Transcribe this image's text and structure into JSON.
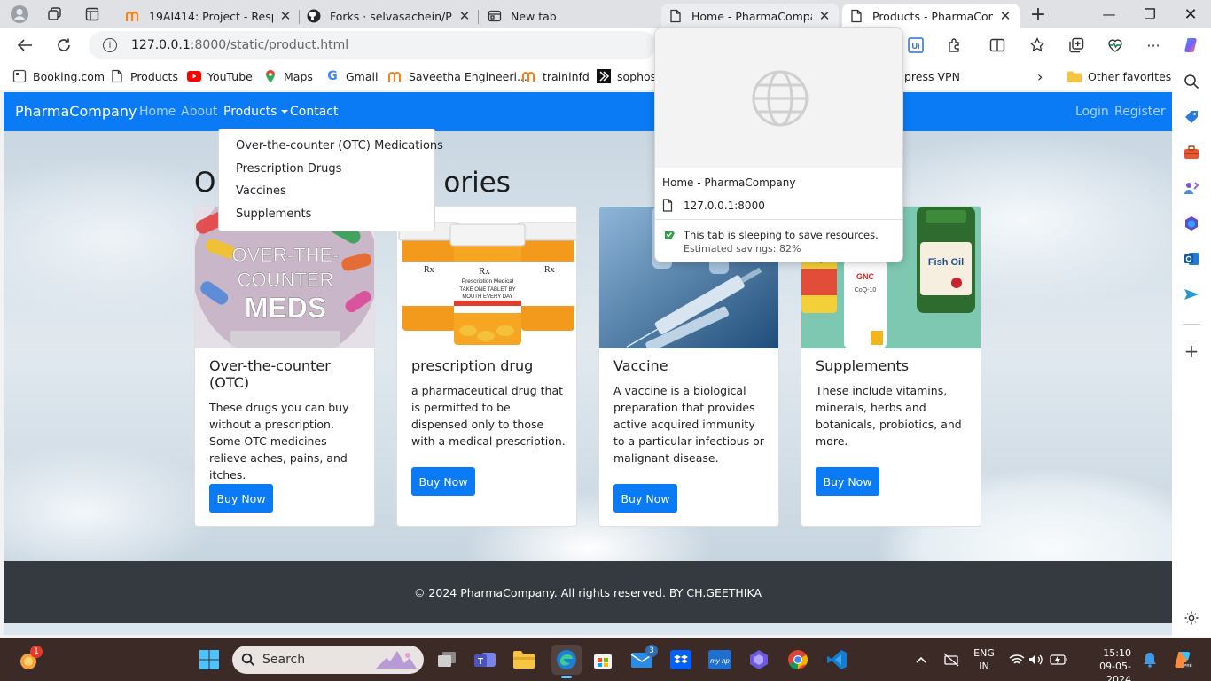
{
  "browser": {
    "tabs": [
      {
        "title": "19AI414: Project - Respon",
        "icon": "moodle-icon"
      },
      {
        "title": "Forks · selvasachein/Pharm",
        "icon": "github-icon"
      },
      {
        "title": "New tab",
        "icon": "newtab-icon"
      },
      {
        "title": "Home - PharmaCompany",
        "icon": "page-icon"
      },
      {
        "title": "Products - PharmaCompa",
        "icon": "page-icon",
        "active": true
      }
    ],
    "address": {
      "host": "127.0.0.1",
      "path": ":8000/static/product.html"
    },
    "bookmarks": [
      {
        "label": "Booking.com",
        "icon": "booking-icon"
      },
      {
        "label": "Products",
        "icon": "page-icon"
      },
      {
        "label": "YouTube",
        "icon": "youtube-icon"
      },
      {
        "label": "Maps",
        "icon": "maps-icon"
      },
      {
        "label": "Gmail",
        "icon": "google-icon"
      },
      {
        "label": "Saveetha Engineeri...",
        "icon": "moodle-icon"
      },
      {
        "label": "traininfd",
        "icon": "moodle-icon"
      },
      {
        "label": "sophos",
        "icon": "sophos-icon"
      },
      {
        "label": "press VPN",
        "icon": "vpn-icon"
      }
    ],
    "other_favorites": "Other favorites",
    "popup": {
      "title": "Home - PharmaCompany",
      "url": "127.0.0.1:8000",
      "status": "This tab is sleeping to save resources.",
      "savings": "Estimated savings: 82%"
    }
  },
  "site": {
    "brand": "PharmaCompany",
    "nav": {
      "home": "Home",
      "about": "About",
      "products": "Products",
      "contact": "Contact",
      "login": "Login",
      "register": "Register"
    },
    "dropdown": [
      "Over-the-counter (OTC) Medications",
      "Prescription Drugs",
      "Vaccines",
      "Supplements"
    ],
    "heading_left": "O",
    "heading_right": "ories",
    "cards": [
      {
        "title": "Over-the-counter (OTC)",
        "text": "These drugs you can buy without a prescription. Some OTC medicines relieve aches, pains, and itches.",
        "button": "Buy Now",
        "image_text": [
          "OVER-THE-",
          "COUNTER",
          "MEDS"
        ]
      },
      {
        "title": "prescription drug",
        "text": "a pharmaceutical drug that is permitted to be dispensed only to those with a medical prescription.",
        "button": "Buy Now",
        "image_text": [
          "Rx",
          "Prescription Medical",
          "TAKE ONE TABLET BY",
          "MOUTH EVERY DAY"
        ]
      },
      {
        "title": "Vaccine",
        "text": "A vaccine is a biological preparation that provides active acquired immunity to a particular infectious or malignant disease.",
        "button": "Buy Now"
      },
      {
        "title": "Supplements",
        "text": "These include vitamins, minerals, herbs and botanicals, probiotics, and more.",
        "button": "Buy Now",
        "image_text": [
          "Fish Oil",
          "GNC",
          "CoQ-10",
          "Omega-3"
        ]
      }
    ],
    "footer": "© 2024 PharmaCompany. All rights reserved. BY CH.GEETHIKA"
  },
  "taskbar": {
    "search_placeholder": "Search",
    "notification_count": "1",
    "mail_badge": "3",
    "lang": "ENG",
    "region": "IN",
    "time": "15:10",
    "date": "09-05-2024"
  },
  "colors": {
    "primary": "#0a7bf5",
    "footer": "#343a40",
    "taskbar": "#3b2a26"
  }
}
